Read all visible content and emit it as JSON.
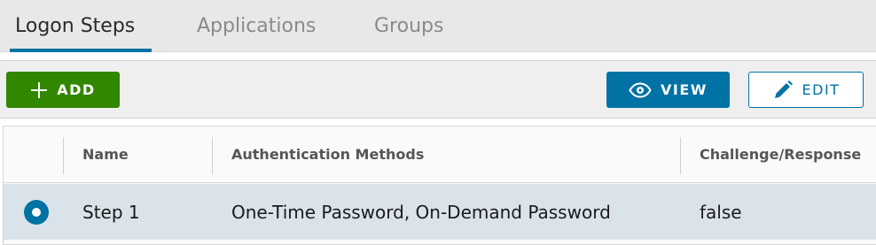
{
  "tabs": {
    "items": [
      {
        "label": "Logon Steps",
        "active": true
      },
      {
        "label": "Applications",
        "active": false
      },
      {
        "label": "Groups",
        "active": false
      }
    ]
  },
  "toolbar": {
    "add_label": "ADD",
    "view_label": "VIEW",
    "edit_label": "EDIT"
  },
  "table": {
    "columns": [
      "Name",
      "Authentication Methods",
      "Challenge/Response"
    ],
    "rows": [
      {
        "selected": true,
        "name": "Step 1",
        "auth_methods": "One-Time Password, On-Demand Password",
        "challenge_response": "false"
      }
    ]
  },
  "colors": {
    "accent": "#0072a3",
    "add_button": "#318700",
    "selected_row": "#dae3ea",
    "tab_bar": "#e8e8e8"
  },
  "icons": {
    "add": "plus-icon",
    "view": "eye-icon",
    "edit": "pencil-icon",
    "row_select": "radio-selected-icon"
  }
}
